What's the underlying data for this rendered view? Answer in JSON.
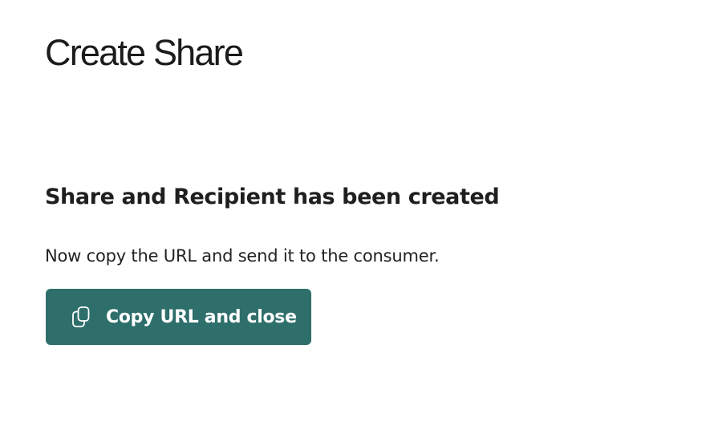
{
  "page": {
    "title": "Create Share"
  },
  "confirmation": {
    "heading": "Share and Recipient has been created",
    "instruction": "Now copy the URL and send it to the consumer."
  },
  "actions": {
    "copy_button": {
      "label": "Copy URL and close",
      "icon": "copy-icon"
    }
  },
  "colors": {
    "primary_button": "#2e6f6b",
    "text": "#1c1c1c",
    "background": "#ffffff"
  }
}
